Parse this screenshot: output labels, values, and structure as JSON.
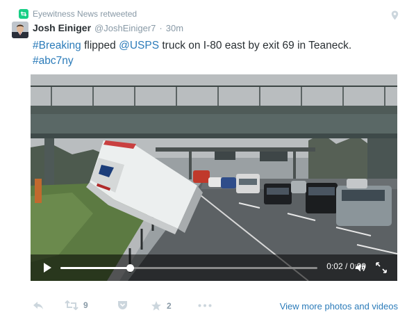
{
  "retweet_notice": {
    "label": "Eyewitness News retweeted",
    "icon": "retweet-icon",
    "color": "#19cf86"
  },
  "tweet": {
    "author_name": "Josh Einiger",
    "author_handle": "@JoshEiniger7",
    "separator": "·",
    "time": "30m",
    "text_parts": {
      "hashtag_breaking": "#Breaking",
      "part1": " flipped ",
      "mention_usps": "@USPS",
      "part2": " truck on I-80 east by exit 69 in Teaneck.",
      "hashtag_abc7ny": "#abc7ny"
    },
    "link_color": "#2b7bb9"
  },
  "video": {
    "current_time": "0:02",
    "separator": " / ",
    "duration": "0:09",
    "progress_fraction": 0.27,
    "icons": [
      "play-icon",
      "volume-icon",
      "fullscreen-icon"
    ]
  },
  "actions": {
    "retweet_count": "9",
    "favorite_count": "2",
    "icons": [
      "reply-icon",
      "retweet-icon",
      "pocket-icon",
      "favorite-icon",
      "more-icon"
    ]
  },
  "view_more_label": "View more photos and videos",
  "header_icons": [
    "location-icon"
  ]
}
